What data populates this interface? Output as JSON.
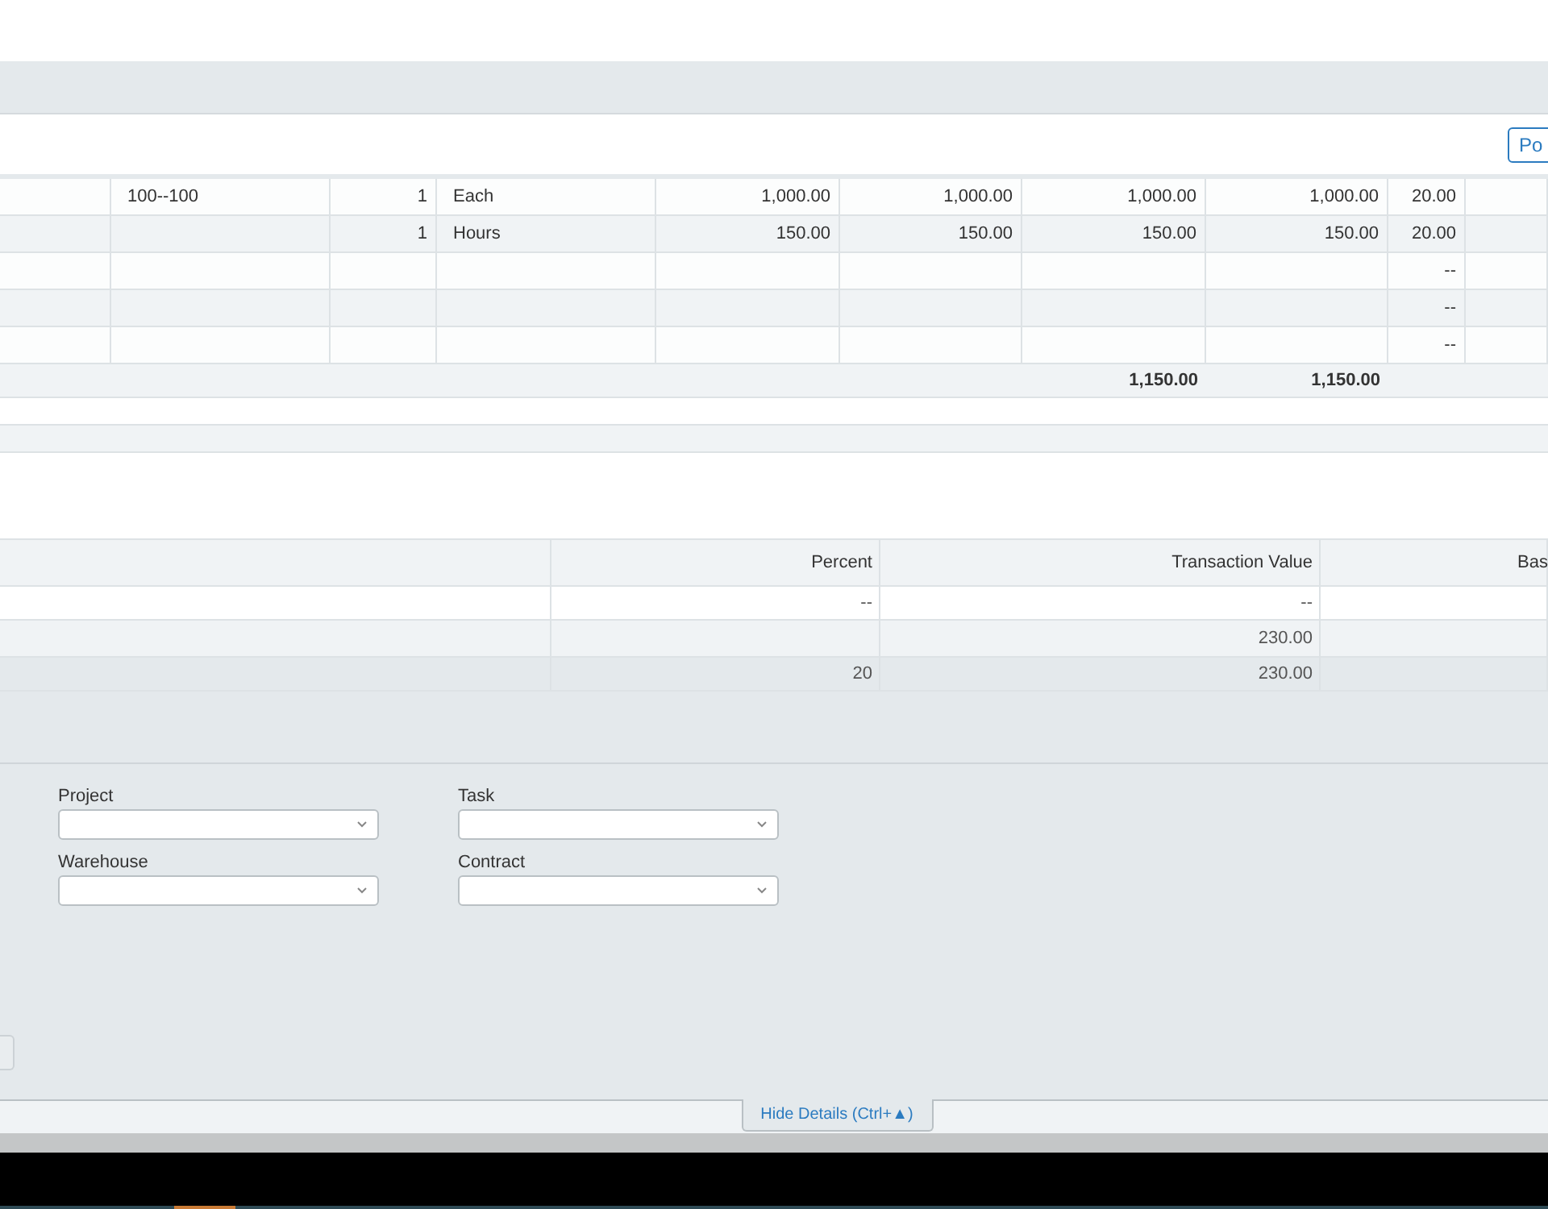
{
  "toolbar": {
    "button": "Po"
  },
  "lines_table": {
    "rows": [
      {
        "column_2": "100--100",
        "column_3": "1",
        "column_4": "Each",
        "column_5": "1,000.00",
        "column_6": "1,000.00",
        "column_7": "1,000.00",
        "column_8": "1,000.00",
        "column_9": "20.00"
      },
      {
        "column_3": "1",
        "column_4": "Hours",
        "column_5": "150.00",
        "column_6": "150.00",
        "column_7": "150.00",
        "column_8": "150.00",
        "column_9": "20.00"
      },
      {
        "column_9": "--"
      },
      {
        "column_9": "--"
      },
      {
        "column_9": "--"
      }
    ],
    "totals": {
      "column_7": "1,150.00",
      "column_8": "1,150.00"
    }
  },
  "tax_table": {
    "columns": [
      "Percent",
      "Transaction Value",
      "Bas"
    ],
    "rows": [
      {
        "percent": "--",
        "transaction_value": "--",
        "selected": false
      },
      {
        "transaction_value": "230.00",
        "selected": false
      },
      {
        "percent": "20",
        "transaction_value": "230.00",
        "selected": true
      }
    ]
  },
  "fields": [
    {
      "label": "Project"
    },
    {
      "label": "Task"
    },
    {
      "label": "Warehouse"
    },
    {
      "label": "Contract"
    }
  ],
  "details_tab": "Hide Details (Ctrl+▲)"
}
